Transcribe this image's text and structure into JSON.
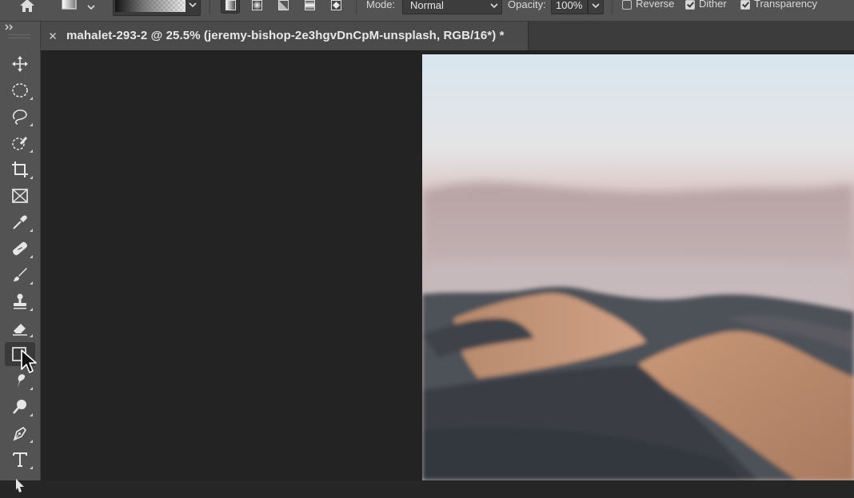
{
  "options_bar": {
    "icons": {
      "home": "home-icon",
      "tool_preset": "gradient-tool-preset-icon",
      "gradient_types": [
        "linear-gradient-icon",
        "radial-gradient-icon",
        "angle-gradient-icon",
        "reflected-gradient-icon",
        "diamond-gradient-icon"
      ]
    },
    "selected_gradient_type": "linear",
    "mode_label": "Mode:",
    "mode_value": "Normal",
    "opacity_label": "Opacity:",
    "opacity_value": "100%",
    "reverse_label": "Reverse",
    "reverse_checked": false,
    "dither_label": "Dither",
    "dither_checked": true,
    "transparency_label": "Transparency",
    "transparency_checked": true
  },
  "toolbar": {
    "collapse_label": "››",
    "tools": [
      {
        "name": "move-tool",
        "icon": "move-icon"
      },
      {
        "name": "elliptical-marquee-tool",
        "icon": "ellipse-marquee-icon"
      },
      {
        "name": "lasso-tool",
        "icon": "lasso-icon"
      },
      {
        "name": "quick-selection-tool",
        "icon": "quick-selection-icon"
      },
      {
        "name": "crop-tool",
        "icon": "crop-icon"
      },
      {
        "name": "frame-tool",
        "icon": "frame-icon"
      },
      {
        "name": "eyedropper-tool",
        "icon": "eyedropper-icon"
      },
      {
        "name": "healing-brush-tool",
        "icon": "bandage-icon"
      },
      {
        "name": "brush-tool",
        "icon": "brush-icon"
      },
      {
        "name": "clone-stamp-tool",
        "icon": "stamp-icon"
      },
      {
        "name": "eraser-tool",
        "icon": "eraser-icon"
      },
      {
        "name": "gradient-tool",
        "icon": "gradient-icon",
        "active": true
      },
      {
        "name": "smudge-tool",
        "icon": "smudge-icon"
      },
      {
        "name": "dodge-tool",
        "icon": "dodge-icon"
      },
      {
        "name": "pen-tool",
        "icon": "pen-icon"
      },
      {
        "name": "type-tool",
        "icon": "type-icon"
      }
    ]
  },
  "document": {
    "close_icon": "close-icon",
    "tab_title": "mahalet-293-2 @ 25.5% (jeremy-bishop-2e3hgvDnCpM-unsplash, RGB/16*) *"
  },
  "colors": {
    "panel": "#535353",
    "canvas_bg": "#232323",
    "tab_bg": "#4a4a4a",
    "text": "#d9d9d9"
  }
}
